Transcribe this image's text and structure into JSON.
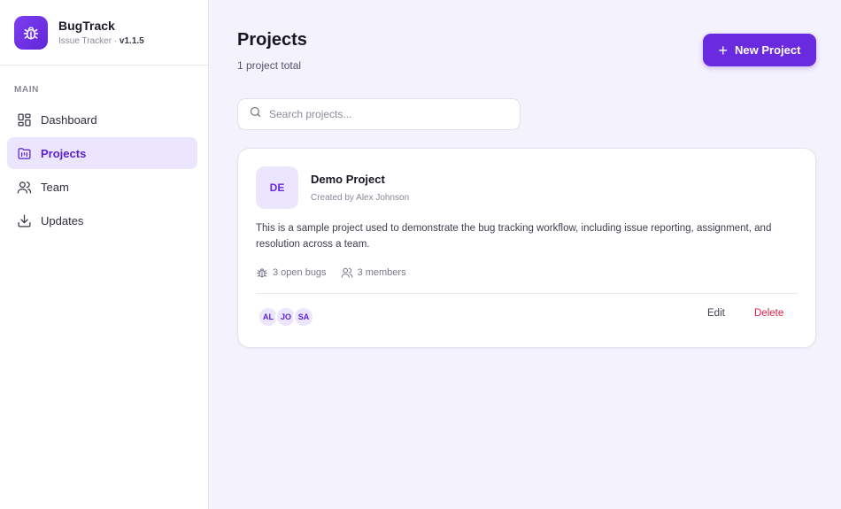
{
  "brand": {
    "name": "BugTrack",
    "subtitle": "Issue Tracker ·",
    "version": "v1.1.5",
    "logo_icon": "bug-icon"
  },
  "sidebar": {
    "section_label": "MAIN",
    "items": [
      {
        "label": "Dashboard",
        "icon": "dashboard-icon",
        "active": false
      },
      {
        "label": "Projects",
        "icon": "projects-folder-icon",
        "active": true
      },
      {
        "label": "Team",
        "icon": "users-icon",
        "active": false
      },
      {
        "label": "Updates",
        "icon": "download-icon",
        "active": false
      }
    ]
  },
  "header": {
    "title": "Projects",
    "subtitle": "1 project total",
    "new_button_label": "New Project"
  },
  "search": {
    "placeholder": "Search projects..."
  },
  "project": {
    "initials": "DE",
    "name": "Demo Project",
    "created_by": "Created by Alex Johnson",
    "description": "This is a sample project used to demonstrate the bug tracking workflow, including issue reporting, assignment, and resolution across a team.",
    "open_bugs": "3 open bugs",
    "members_count": "3 members",
    "members": [
      "AL",
      "JO",
      "SA"
    ],
    "edit_label": "Edit",
    "delete_label": "Delete"
  },
  "colors": {
    "accent": "#6a2be0",
    "accent_light": "#ebe5fd",
    "danger": "#e11d48",
    "background": "#f4f2fd"
  }
}
